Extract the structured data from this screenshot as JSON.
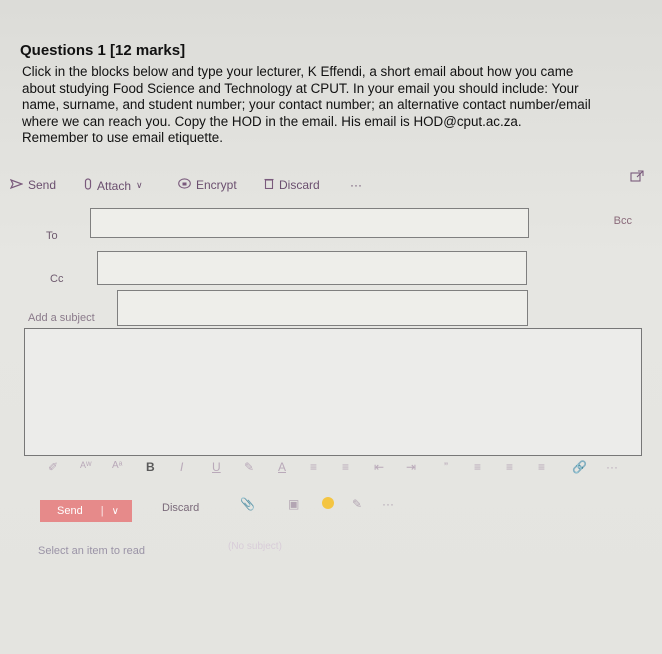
{
  "question": {
    "title": "Questions 1 [12 marks]",
    "lines": [
      "Click in the blocks below and type your lecturer, K Effendi, a short email about how you came",
      "about studying Food Science and Technology at CPUT. In your email you should include: Your",
      "name, surname, and student number; your contact number; an alternative contact number/email",
      "where we can reach you. Copy the HOD in the email. His email is HOD@cput.ac.za.",
      "Remember to use email etiquette."
    ]
  },
  "toolbar": {
    "send": "Send",
    "attach": "Attach",
    "encrypt": "Encrypt",
    "discard": "Discard",
    "more": "···"
  },
  "compose": {
    "to_label": "To",
    "cc_label": "Cc",
    "bcc_label": "Bcc",
    "subject_placeholder": "Add a subject"
  },
  "format_bar": {
    "bold": "B",
    "italic": "I",
    "underline": "U",
    "more": "···"
  },
  "footer": {
    "send": "Send",
    "discard": "Discard",
    "read_hint": "Select an item to read",
    "no_subject": "(No subject)"
  }
}
